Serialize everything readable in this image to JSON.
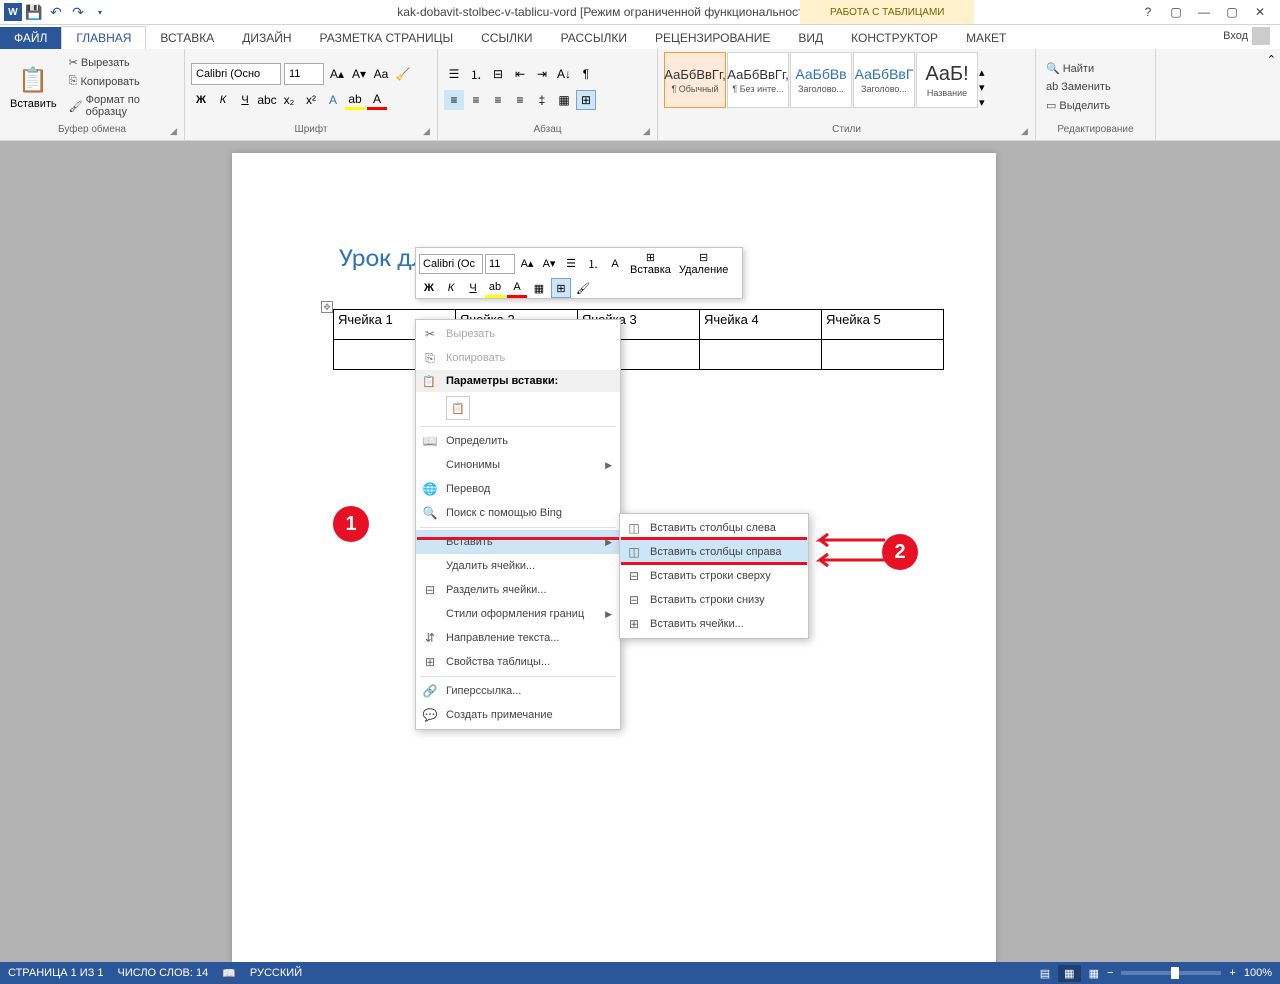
{
  "title": "kak-dobavit-stolbec-v-tablicu-vord [Режим ограниченной функциональности] - Word",
  "table_tools": "РАБОТА С ТАБЛИЦАМИ",
  "tabs": {
    "file": "ФАЙЛ",
    "home": "ГЛАВНАЯ",
    "insert": "ВСТАВКА",
    "design": "ДИЗАЙН",
    "layout": "РАЗМЕТКА СТРАНИЦЫ",
    "refs": "ССЫЛКИ",
    "mail": "РАССЫЛКИ",
    "review": "РЕЦЕНЗИРОВАНИЕ",
    "view": "ВИД",
    "designer": "КОНСТРУКТОР",
    "tlayout": "МАКЕТ"
  },
  "signin": "Вход",
  "clipboard": {
    "paste": "Вставить",
    "cut": "Вырезать",
    "copy": "Копировать",
    "formatpainter": "Формат по образцу",
    "label": "Буфер обмена"
  },
  "font": {
    "name": "Calibri (Осно",
    "size": "11",
    "label": "Шрифт"
  },
  "para": {
    "label": "Абзац"
  },
  "styles": {
    "normal": "¶ Обычный",
    "nospace": "¶ Без инте...",
    "h1": "Заголово...",
    "h2": "Заголово...",
    "title": "Название",
    "label": "Стили",
    "ex": "АаБбВвГг,",
    "ex2": "АаБбВвГг,",
    "ex3": "АаБбВв",
    "ex4": "АаБбВвГ",
    "ex5": "АаБ!"
  },
  "editing": {
    "find": "Найти",
    "replace": "Заменить",
    "select": "Выделить",
    "label": "Редактирование"
  },
  "doc": {
    "title": "Урок для сайта paratapok.ru",
    "cells": [
      "Ячейка 1",
      "Ячейка 2",
      "Ячейка 3",
      "Ячейка 4",
      "Ячейка 5"
    ]
  },
  "mini": {
    "font": "Calibri (Ос",
    "size": "11",
    "insert": "Вставка",
    "delete": "Удаление"
  },
  "ctx": {
    "cut": "Вырезать",
    "copy": "Копировать",
    "pasteopts": "Параметры вставки:",
    "define": "Определить",
    "syn": "Синонимы",
    "trans": "Перевод",
    "bing": "Поиск с помощью Bing",
    "ins": "Вставить",
    "delcells": "Удалить ячейки...",
    "split": "Разделить ячейки...",
    "borders": "Стили оформления границ",
    "textdir": "Направление текста...",
    "props": "Свойства таблицы...",
    "link": "Гиперссылка...",
    "comment": "Создать примечание"
  },
  "sub": {
    "colsleft": "Вставить столбцы слева",
    "colsright": "Вставить столбцы справа",
    "rowsabove": "Вставить строки сверху",
    "rowsbelow": "Вставить строки снизу",
    "cells": "Вставить ячейки..."
  },
  "status": {
    "page": "СТРАНИЦА 1 ИЗ 1",
    "words": "ЧИСЛО СЛОВ: 14",
    "lang": "РУССКИЙ",
    "zoom": "100%"
  },
  "markers": {
    "1": "1",
    "2": "2"
  }
}
